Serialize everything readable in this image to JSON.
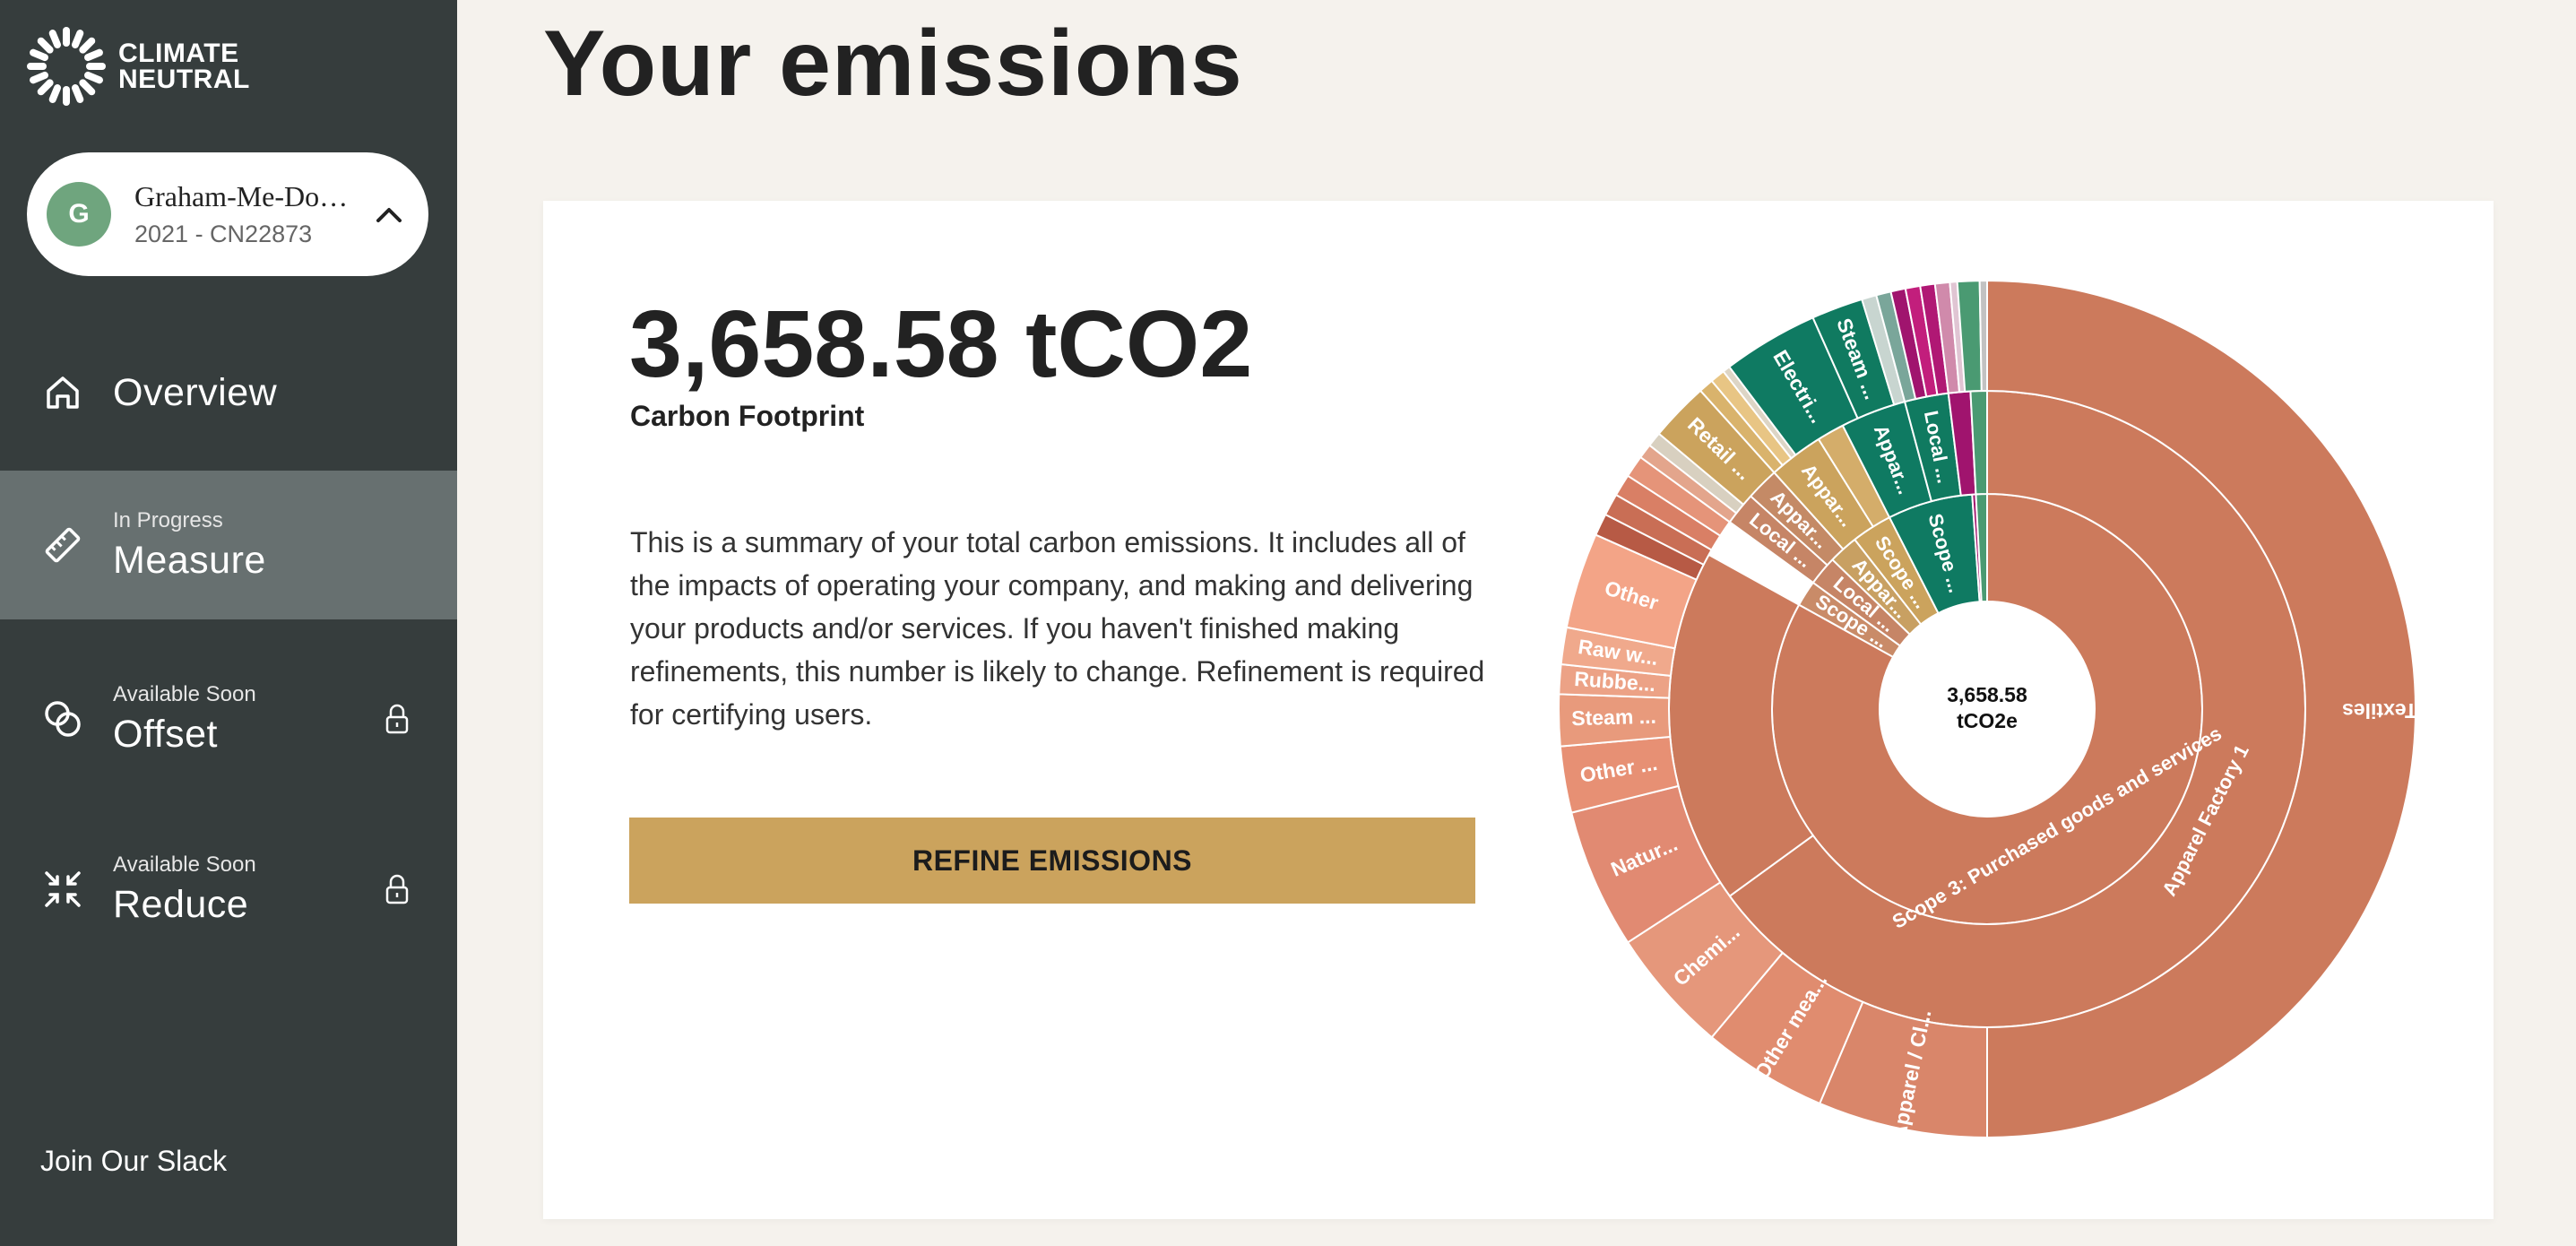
{
  "brand": {
    "logo_text_line1": "CLIMATE",
    "logo_text_line2": "NEUTRAL"
  },
  "org": {
    "avatar_letter": "G",
    "name": "Graham-Me-Do…",
    "subtitle": "2021 - CN22873"
  },
  "nav": [
    {
      "status": "",
      "label": "Overview",
      "icon": "home-icon",
      "active": false,
      "locked": false
    },
    {
      "status": "In Progress",
      "label": "Measure",
      "icon": "ruler-icon",
      "active": true,
      "locked": false
    },
    {
      "status": "Available Soon",
      "label": "Offset",
      "icon": "offset-circles-icon",
      "active": false,
      "locked": true
    },
    {
      "status": "Available Soon",
      "label": "Reduce",
      "icon": "reduce-arrows-icon",
      "active": false,
      "locked": true
    }
  ],
  "footer": {
    "slack_link": "Join Our Slack"
  },
  "page": {
    "title": "Your emissions"
  },
  "summary": {
    "total": "3,658.58 tCO2",
    "total_label": "Carbon Footprint",
    "description": "This is a summary of your total carbon emissions. It includes all of the impacts of operating your company, and making and delivering your products and/or services. If you haven't finished making refinements, this number is likely to change. Refinement is required for certifying users.",
    "refine_button": "REFINE EMISSIONS"
  },
  "colors": {
    "sidebar": "#363d3d",
    "active_nav": "#677070",
    "accent_gold": "#cba35d",
    "avatar": "#6fa57e",
    "scope3": "#cc7a5c",
    "green": "#0f7a62",
    "magenta": "#a0146e",
    "salmon": "#f3a487"
  },
  "chart_data": {
    "type": "sunburst",
    "center_label_line1": "3,658.58",
    "center_label_line2": "tCO2e",
    "inner_ring": [
      {
        "label": "Scope 3: Purchased goods and services",
        "start_deg": 0,
        "end_deg": 299,
        "color": "#cc7a5c"
      },
      {
        "label": "Scope ...",
        "start_deg": 299,
        "end_deg": 306,
        "color": "#c98b68"
      },
      {
        "label": "Local ...",
        "start_deg": 306,
        "end_deg": 314,
        "color": "#c68566"
      },
      {
        "label": "Appar...",
        "start_deg": 314,
        "end_deg": 322,
        "color": "#c8a062"
      },
      {
        "label": "Scope ...",
        "start_deg": 322,
        "end_deg": 333,
        "color": "#cba35d"
      },
      {
        "label": "Scope ...",
        "start_deg": 333,
        "end_deg": 356,
        "color": "#0f7a62"
      },
      {
        "label": "",
        "start_deg": 356,
        "end_deg": 357,
        "color": "#a0146e"
      },
      {
        "label": "",
        "start_deg": 357,
        "end_deg": 360,
        "color": "#4a9a72"
      }
    ],
    "middle_ring": [
      {
        "label": "Apparel Factory 1",
        "start_deg": 0,
        "end_deg": 234,
        "color": "#cc7a5c"
      },
      {
        "label": "",
        "start_deg": 234,
        "end_deg": 299,
        "color": "#cc7a5c"
      },
      {
        "label": "Local ...",
        "start_deg": 306,
        "end_deg": 312,
        "color": "#c68566"
      },
      {
        "label": "Appar...",
        "start_deg": 312,
        "end_deg": 318,
        "color": "#c48a66"
      },
      {
        "label": "Appar...",
        "start_deg": 318,
        "end_deg": 328,
        "color": "#cba35d"
      },
      {
        "label": "",
        "start_deg": 328,
        "end_deg": 333,
        "color": "#d4ad6a"
      },
      {
        "label": "Appar...",
        "start_deg": 333,
        "end_deg": 345,
        "color": "#0f7a62"
      },
      {
        "label": "Local ...",
        "start_deg": 345,
        "end_deg": 353,
        "color": "#107a60"
      },
      {
        "label": "",
        "start_deg": 353,
        "end_deg": 357,
        "color": "#a0146e"
      },
      {
        "label": "",
        "start_deg": 357,
        "end_deg": 360,
        "color": "#4a9a72"
      }
    ],
    "outer_ring": [
      {
        "label": "Textiles",
        "start_deg": 0,
        "end_deg": 180,
        "color": "#cc7a5c"
      },
      {
        "label": "Apparel / Cl...",
        "start_deg": 180,
        "end_deg": 203,
        "color": "#d9866a"
      },
      {
        "label": "Other mea...",
        "start_deg": 203,
        "end_deg": 220,
        "color": "#e08c6f"
      },
      {
        "label": "Chemi...",
        "start_deg": 220,
        "end_deg": 237,
        "color": "#e5977b"
      },
      {
        "label": "Natur...",
        "start_deg": 237,
        "end_deg": 256,
        "color": "#e18a72"
      },
      {
        "label": "Other ...",
        "start_deg": 256,
        "end_deg": 265,
        "color": "#e79074"
      },
      {
        "label": "Steam ...",
        "start_deg": 265,
        "end_deg": 272,
        "color": "#e89a7c"
      },
      {
        "label": "Rubbe...",
        "start_deg": 272,
        "end_deg": 276,
        "color": "#eca286"
      },
      {
        "label": "Raw w...",
        "start_deg": 276,
        "end_deg": 281,
        "color": "#f0a98c"
      },
      {
        "label": "Other",
        "start_deg": 281,
        "end_deg": 294,
        "color": "#f3a487"
      },
      {
        "label": "",
        "start_deg": 294,
        "end_deg": 297,
        "color": "#b75a45"
      },
      {
        "label": "",
        "start_deg": 297,
        "end_deg": 300,
        "color": "#c96e55"
      },
      {
        "label": "",
        "start_deg": 300,
        "end_deg": 303,
        "color": "#d97f65"
      },
      {
        "label": "",
        "start_deg": 303,
        "end_deg": 306,
        "color": "#e59479"
      },
      {
        "label": "",
        "start_deg": 306,
        "end_deg": 308,
        "color": "#e3a58c"
      },
      {
        "label": "",
        "start_deg": 308,
        "end_deg": 310,
        "color": "#d8d0c0"
      },
      {
        "label": "Retail ...",
        "start_deg": 310,
        "end_deg": 318,
        "color": "#cba35d"
      },
      {
        "label": "",
        "start_deg": 318,
        "end_deg": 320,
        "color": "#d9b36c"
      },
      {
        "label": "",
        "start_deg": 320,
        "end_deg": 322,
        "color": "#e8c584"
      },
      {
        "label": "",
        "start_deg": 322,
        "end_deg": 323,
        "color": "#ddd5c5"
      },
      {
        "label": "Electri...",
        "start_deg": 323,
        "end_deg": 336,
        "color": "#0f7a62"
      },
      {
        "label": "Steam ...",
        "start_deg": 336,
        "end_deg": 343,
        "color": "#107a60"
      },
      {
        "label": "",
        "start_deg": 343,
        "end_deg": 345,
        "color": "#c8d5d0"
      },
      {
        "label": "",
        "start_deg": 345,
        "end_deg": 347,
        "color": "#7aa69a"
      },
      {
        "label": "",
        "start_deg": 347,
        "end_deg": 349,
        "color": "#a0146e"
      },
      {
        "label": "",
        "start_deg": 349,
        "end_deg": 351,
        "color": "#c21e7c"
      },
      {
        "label": "",
        "start_deg": 351,
        "end_deg": 353,
        "color": "#b01874"
      },
      {
        "label": "",
        "start_deg": 353,
        "end_deg": 355,
        "color": "#d08aab"
      },
      {
        "label": "",
        "start_deg": 355,
        "end_deg": 356,
        "color": "#e0c5d3"
      },
      {
        "label": "",
        "start_deg": 356,
        "end_deg": 359,
        "color": "#4a9a72"
      },
      {
        "label": "",
        "start_deg": 359,
        "end_deg": 360,
        "color": "#c2c2c2"
      }
    ]
  }
}
